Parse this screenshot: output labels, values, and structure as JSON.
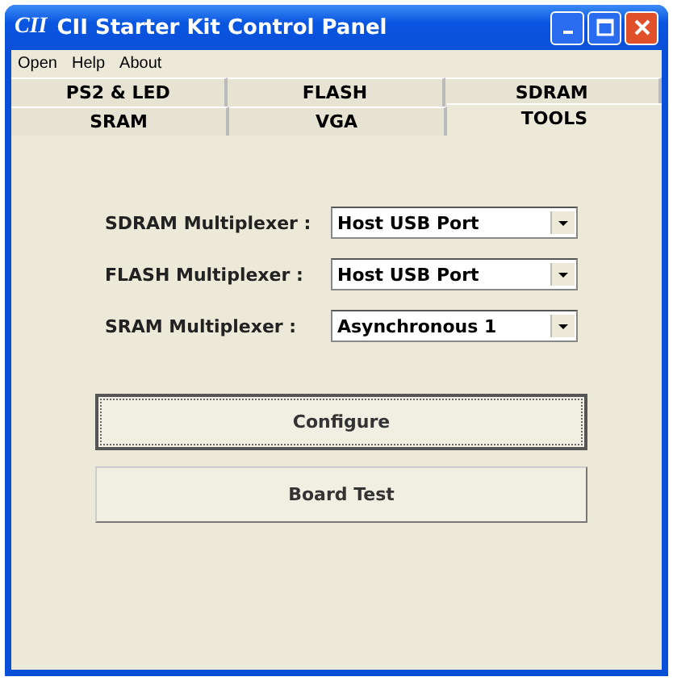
{
  "window": {
    "title": "CII Starter Kit Control Panel",
    "logo": "CII"
  },
  "menu": [
    "Open",
    "Help",
    "About"
  ],
  "tab_rows": [
    [
      {
        "label": "PS2 & LED",
        "selected": false
      },
      {
        "label": "FLASH",
        "selected": false
      },
      {
        "label": "SDRAM",
        "selected": false
      }
    ],
    [
      {
        "label": "SRAM",
        "selected": false
      },
      {
        "label": "VGA",
        "selected": false
      },
      {
        "label": "TOOLS",
        "selected": true
      }
    ]
  ],
  "fields": [
    {
      "label": "SDRAM Multiplexer :",
      "value": "Host USB Port"
    },
    {
      "label": "FLASH Multiplexer :",
      "value": "Host USB Port"
    },
    {
      "label": "SRAM Multiplexer :",
      "value": "Asynchronous 1"
    }
  ],
  "buttons": [
    {
      "label": "Configure",
      "focused": true
    },
    {
      "label": "Board Test",
      "focused": false
    }
  ]
}
